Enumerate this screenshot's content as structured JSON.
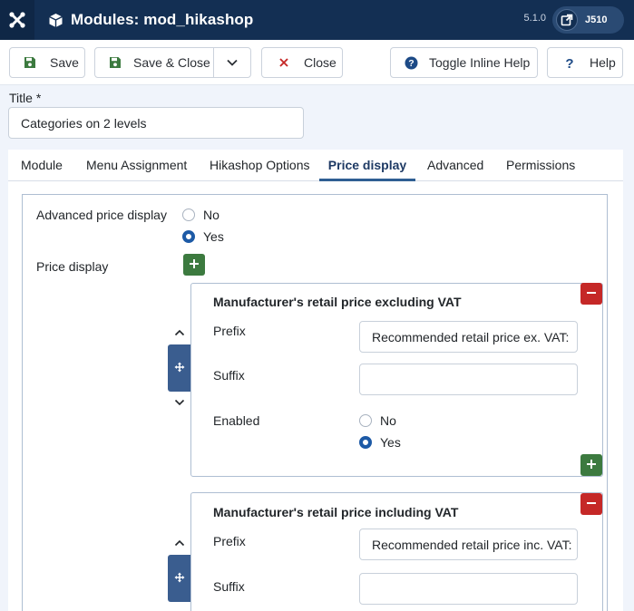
{
  "header": {
    "title": "Modules: mod_hikashop",
    "version": "5.1.0",
    "user": "J510"
  },
  "toolbar": {
    "save": "Save",
    "save_close": "Save & Close",
    "close": "Close",
    "toggle_help": "Toggle Inline Help",
    "help": "Help"
  },
  "form": {
    "title_label": "Title *",
    "title_value": "Categories on 2 levels"
  },
  "tabs": [
    {
      "label": "Module"
    },
    {
      "label": "Menu Assignment"
    },
    {
      "label": "Hikashop Options"
    },
    {
      "label": "Price display"
    },
    {
      "label": "Advanced"
    },
    {
      "label": "Permissions"
    }
  ],
  "active_tab": "Price display",
  "price_tab": {
    "advanced_label": "Advanced price display",
    "advanced_options": [
      "No",
      "Yes"
    ],
    "advanced_selected": "Yes",
    "price_display_label": "Price display",
    "entries": [
      {
        "title": "Manufacturer's retail price excluding VAT",
        "prefix_label": "Prefix",
        "prefix_value": "Recommended retail price ex. VAT:",
        "suffix_label": "Suffix",
        "suffix_value": "",
        "enabled_label": "Enabled",
        "enabled_options": [
          "No",
          "Yes"
        ],
        "enabled_selected": "Yes"
      },
      {
        "title": "Manufacturer's retail price including VAT",
        "prefix_label": "Prefix",
        "prefix_value": "Recommended retail price inc. VAT:",
        "suffix_label": "Suffix",
        "suffix_value": ""
      }
    ]
  },
  "colors": {
    "header_bg": "#132f53",
    "add_green": "#3c7a3f",
    "remove_red": "#c52827",
    "radio_blue": "#1d5aa6",
    "handle_blue": "#3a5d8f"
  }
}
